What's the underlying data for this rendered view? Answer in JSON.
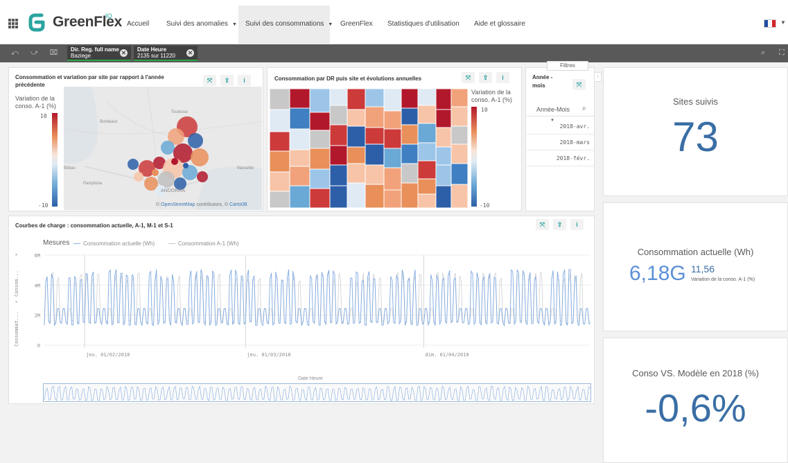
{
  "app": {
    "brand": "GreenFlex",
    "brand_sup": "IQ",
    "nav": [
      "Accueil",
      "Suivi des anomalies",
      "Suivi des consommations",
      "GreenFlex",
      "Statistiques d'utilisation",
      "Aide et glossaire"
    ],
    "flag_colors": [
      "#1f4ea3",
      "#ffffff",
      "#d8232a"
    ]
  },
  "selections": [
    {
      "field": "Dir. Reg. full name",
      "value": "Baziege"
    },
    {
      "field": "Date Heure",
      "value": "2135 sur 11220"
    }
  ],
  "map_panel": {
    "title": "Consommation et variation par site par rapport à l'année précédente",
    "legend_title": "Variation de la conso. A-1 (%)",
    "legend_max": "10",
    "legend_min": "-10",
    "labels": [
      "Bordeaux",
      "Bilbao",
      "Pamplona",
      "Toulouse",
      "Marseille",
      "ANDORRA"
    ],
    "credit_prefix": "© ",
    "credit_link1": "OpenStreetMap",
    "credit_mid": " contributors, © ",
    "credit_link2": "Carto0B"
  },
  "treemap_panel": {
    "title": "Consommation par DR puis site et évolutions annuelles",
    "legend_title": "Variation de la conso. A-1 (%)",
    "legend_max": "10",
    "legend_min": "-10"
  },
  "filter_panel": {
    "tab": "Filtres",
    "title": "Année - mois",
    "search_label": "Année-Mois",
    "items": [
      "2018-avr.",
      "2018-mars",
      "2018-févr."
    ]
  },
  "kpis": [
    {
      "title": "Sites suivis",
      "value": "73"
    },
    {
      "title": "Consommation actuelle (Wh)",
      "value": "6,18G",
      "secondary": "11,56",
      "secondary_label": "Variation de la conso. A-1 (%)"
    },
    {
      "title": "Conso VS. Modèle en 2018 (%)",
      "value": "-0,6%"
    }
  ],
  "line_panel": {
    "title": "Courbes de charge : consommation actuelle, A-1, M-1 et S-1",
    "legend_label": "Mesures",
    "y_label_1": "Consom...",
    "y_label_2": "Consommat...",
    "x_label": "Date Heure"
  },
  "chart_data": {
    "type": "line",
    "series": [
      {
        "name": "Consommation actuelle (Wh)"
      },
      {
        "name": "Consommation A-1 (Wh)"
      }
    ],
    "y_ticks": [
      "6M",
      "4M",
      "2M",
      "0"
    ],
    "ylim": [
      0,
      6000000
    ],
    "x_ticks": [
      "jeu. 01/02/2018",
      "jeu. 01/03/2018",
      "dim. 01/04/2018"
    ],
    "x_range": [
      "2018-01-25",
      "2018-04-30"
    ],
    "pattern": "daily cycles between about 1.5M and 5.5M Wh, lower on weekends"
  }
}
